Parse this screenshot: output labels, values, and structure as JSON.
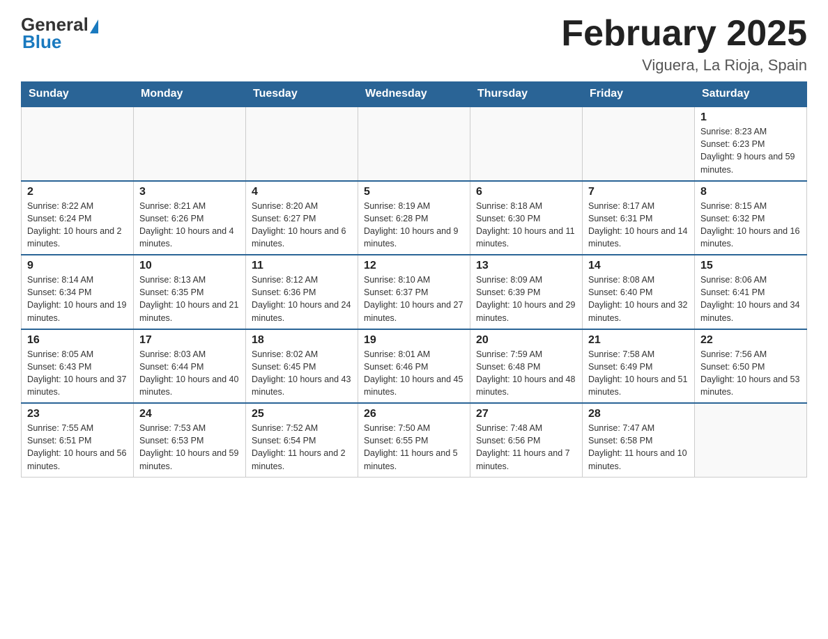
{
  "header": {
    "logo": {
      "general": "General",
      "blue": "Blue"
    },
    "title": "February 2025",
    "location": "Viguera, La Rioja, Spain"
  },
  "weekdays": [
    "Sunday",
    "Monday",
    "Tuesday",
    "Wednesday",
    "Thursday",
    "Friday",
    "Saturday"
  ],
  "weeks": [
    [
      {
        "day": "",
        "info": ""
      },
      {
        "day": "",
        "info": ""
      },
      {
        "day": "",
        "info": ""
      },
      {
        "day": "",
        "info": ""
      },
      {
        "day": "",
        "info": ""
      },
      {
        "day": "",
        "info": ""
      },
      {
        "day": "1",
        "info": "Sunrise: 8:23 AM\nSunset: 6:23 PM\nDaylight: 9 hours and 59 minutes."
      }
    ],
    [
      {
        "day": "2",
        "info": "Sunrise: 8:22 AM\nSunset: 6:24 PM\nDaylight: 10 hours and 2 minutes."
      },
      {
        "day": "3",
        "info": "Sunrise: 8:21 AM\nSunset: 6:26 PM\nDaylight: 10 hours and 4 minutes."
      },
      {
        "day": "4",
        "info": "Sunrise: 8:20 AM\nSunset: 6:27 PM\nDaylight: 10 hours and 6 minutes."
      },
      {
        "day": "5",
        "info": "Sunrise: 8:19 AM\nSunset: 6:28 PM\nDaylight: 10 hours and 9 minutes."
      },
      {
        "day": "6",
        "info": "Sunrise: 8:18 AM\nSunset: 6:30 PM\nDaylight: 10 hours and 11 minutes."
      },
      {
        "day": "7",
        "info": "Sunrise: 8:17 AM\nSunset: 6:31 PM\nDaylight: 10 hours and 14 minutes."
      },
      {
        "day": "8",
        "info": "Sunrise: 8:15 AM\nSunset: 6:32 PM\nDaylight: 10 hours and 16 minutes."
      }
    ],
    [
      {
        "day": "9",
        "info": "Sunrise: 8:14 AM\nSunset: 6:34 PM\nDaylight: 10 hours and 19 minutes."
      },
      {
        "day": "10",
        "info": "Sunrise: 8:13 AM\nSunset: 6:35 PM\nDaylight: 10 hours and 21 minutes."
      },
      {
        "day": "11",
        "info": "Sunrise: 8:12 AM\nSunset: 6:36 PM\nDaylight: 10 hours and 24 minutes."
      },
      {
        "day": "12",
        "info": "Sunrise: 8:10 AM\nSunset: 6:37 PM\nDaylight: 10 hours and 27 minutes."
      },
      {
        "day": "13",
        "info": "Sunrise: 8:09 AM\nSunset: 6:39 PM\nDaylight: 10 hours and 29 minutes."
      },
      {
        "day": "14",
        "info": "Sunrise: 8:08 AM\nSunset: 6:40 PM\nDaylight: 10 hours and 32 minutes."
      },
      {
        "day": "15",
        "info": "Sunrise: 8:06 AM\nSunset: 6:41 PM\nDaylight: 10 hours and 34 minutes."
      }
    ],
    [
      {
        "day": "16",
        "info": "Sunrise: 8:05 AM\nSunset: 6:43 PM\nDaylight: 10 hours and 37 minutes."
      },
      {
        "day": "17",
        "info": "Sunrise: 8:03 AM\nSunset: 6:44 PM\nDaylight: 10 hours and 40 minutes."
      },
      {
        "day": "18",
        "info": "Sunrise: 8:02 AM\nSunset: 6:45 PM\nDaylight: 10 hours and 43 minutes."
      },
      {
        "day": "19",
        "info": "Sunrise: 8:01 AM\nSunset: 6:46 PM\nDaylight: 10 hours and 45 minutes."
      },
      {
        "day": "20",
        "info": "Sunrise: 7:59 AM\nSunset: 6:48 PM\nDaylight: 10 hours and 48 minutes."
      },
      {
        "day": "21",
        "info": "Sunrise: 7:58 AM\nSunset: 6:49 PM\nDaylight: 10 hours and 51 minutes."
      },
      {
        "day": "22",
        "info": "Sunrise: 7:56 AM\nSunset: 6:50 PM\nDaylight: 10 hours and 53 minutes."
      }
    ],
    [
      {
        "day": "23",
        "info": "Sunrise: 7:55 AM\nSunset: 6:51 PM\nDaylight: 10 hours and 56 minutes."
      },
      {
        "day": "24",
        "info": "Sunrise: 7:53 AM\nSunset: 6:53 PM\nDaylight: 10 hours and 59 minutes."
      },
      {
        "day": "25",
        "info": "Sunrise: 7:52 AM\nSunset: 6:54 PM\nDaylight: 11 hours and 2 minutes."
      },
      {
        "day": "26",
        "info": "Sunrise: 7:50 AM\nSunset: 6:55 PM\nDaylight: 11 hours and 5 minutes."
      },
      {
        "day": "27",
        "info": "Sunrise: 7:48 AM\nSunset: 6:56 PM\nDaylight: 11 hours and 7 minutes."
      },
      {
        "day": "28",
        "info": "Sunrise: 7:47 AM\nSunset: 6:58 PM\nDaylight: 11 hours and 10 minutes."
      },
      {
        "day": "",
        "info": ""
      }
    ]
  ]
}
